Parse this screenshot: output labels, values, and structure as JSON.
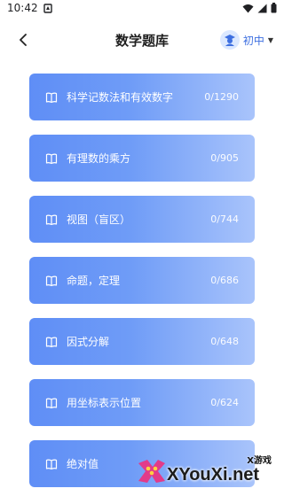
{
  "status_bar": {
    "time": "10:42"
  },
  "header": {
    "title": "数学题库",
    "grade": "初中"
  },
  "topics": [
    {
      "name": "科学记数法和有效数字",
      "progress": "0/1290"
    },
    {
      "name": "有理数的乘方",
      "progress": "0/905"
    },
    {
      "name": "视图（盲区）",
      "progress": "0/744"
    },
    {
      "name": "命题，定理",
      "progress": "0/686"
    },
    {
      "name": "因式分解",
      "progress": "0/648"
    },
    {
      "name": "用坐标表示位置",
      "progress": "0/624"
    },
    {
      "name": "绝对值",
      "progress": ""
    }
  ],
  "watermark": {
    "small": "X游戏",
    "brand": "XYouXi.net"
  },
  "colors": {
    "card_start": "#5f8ef6",
    "card_end": "#a9c4fb",
    "accent": "#3d6fe0"
  }
}
